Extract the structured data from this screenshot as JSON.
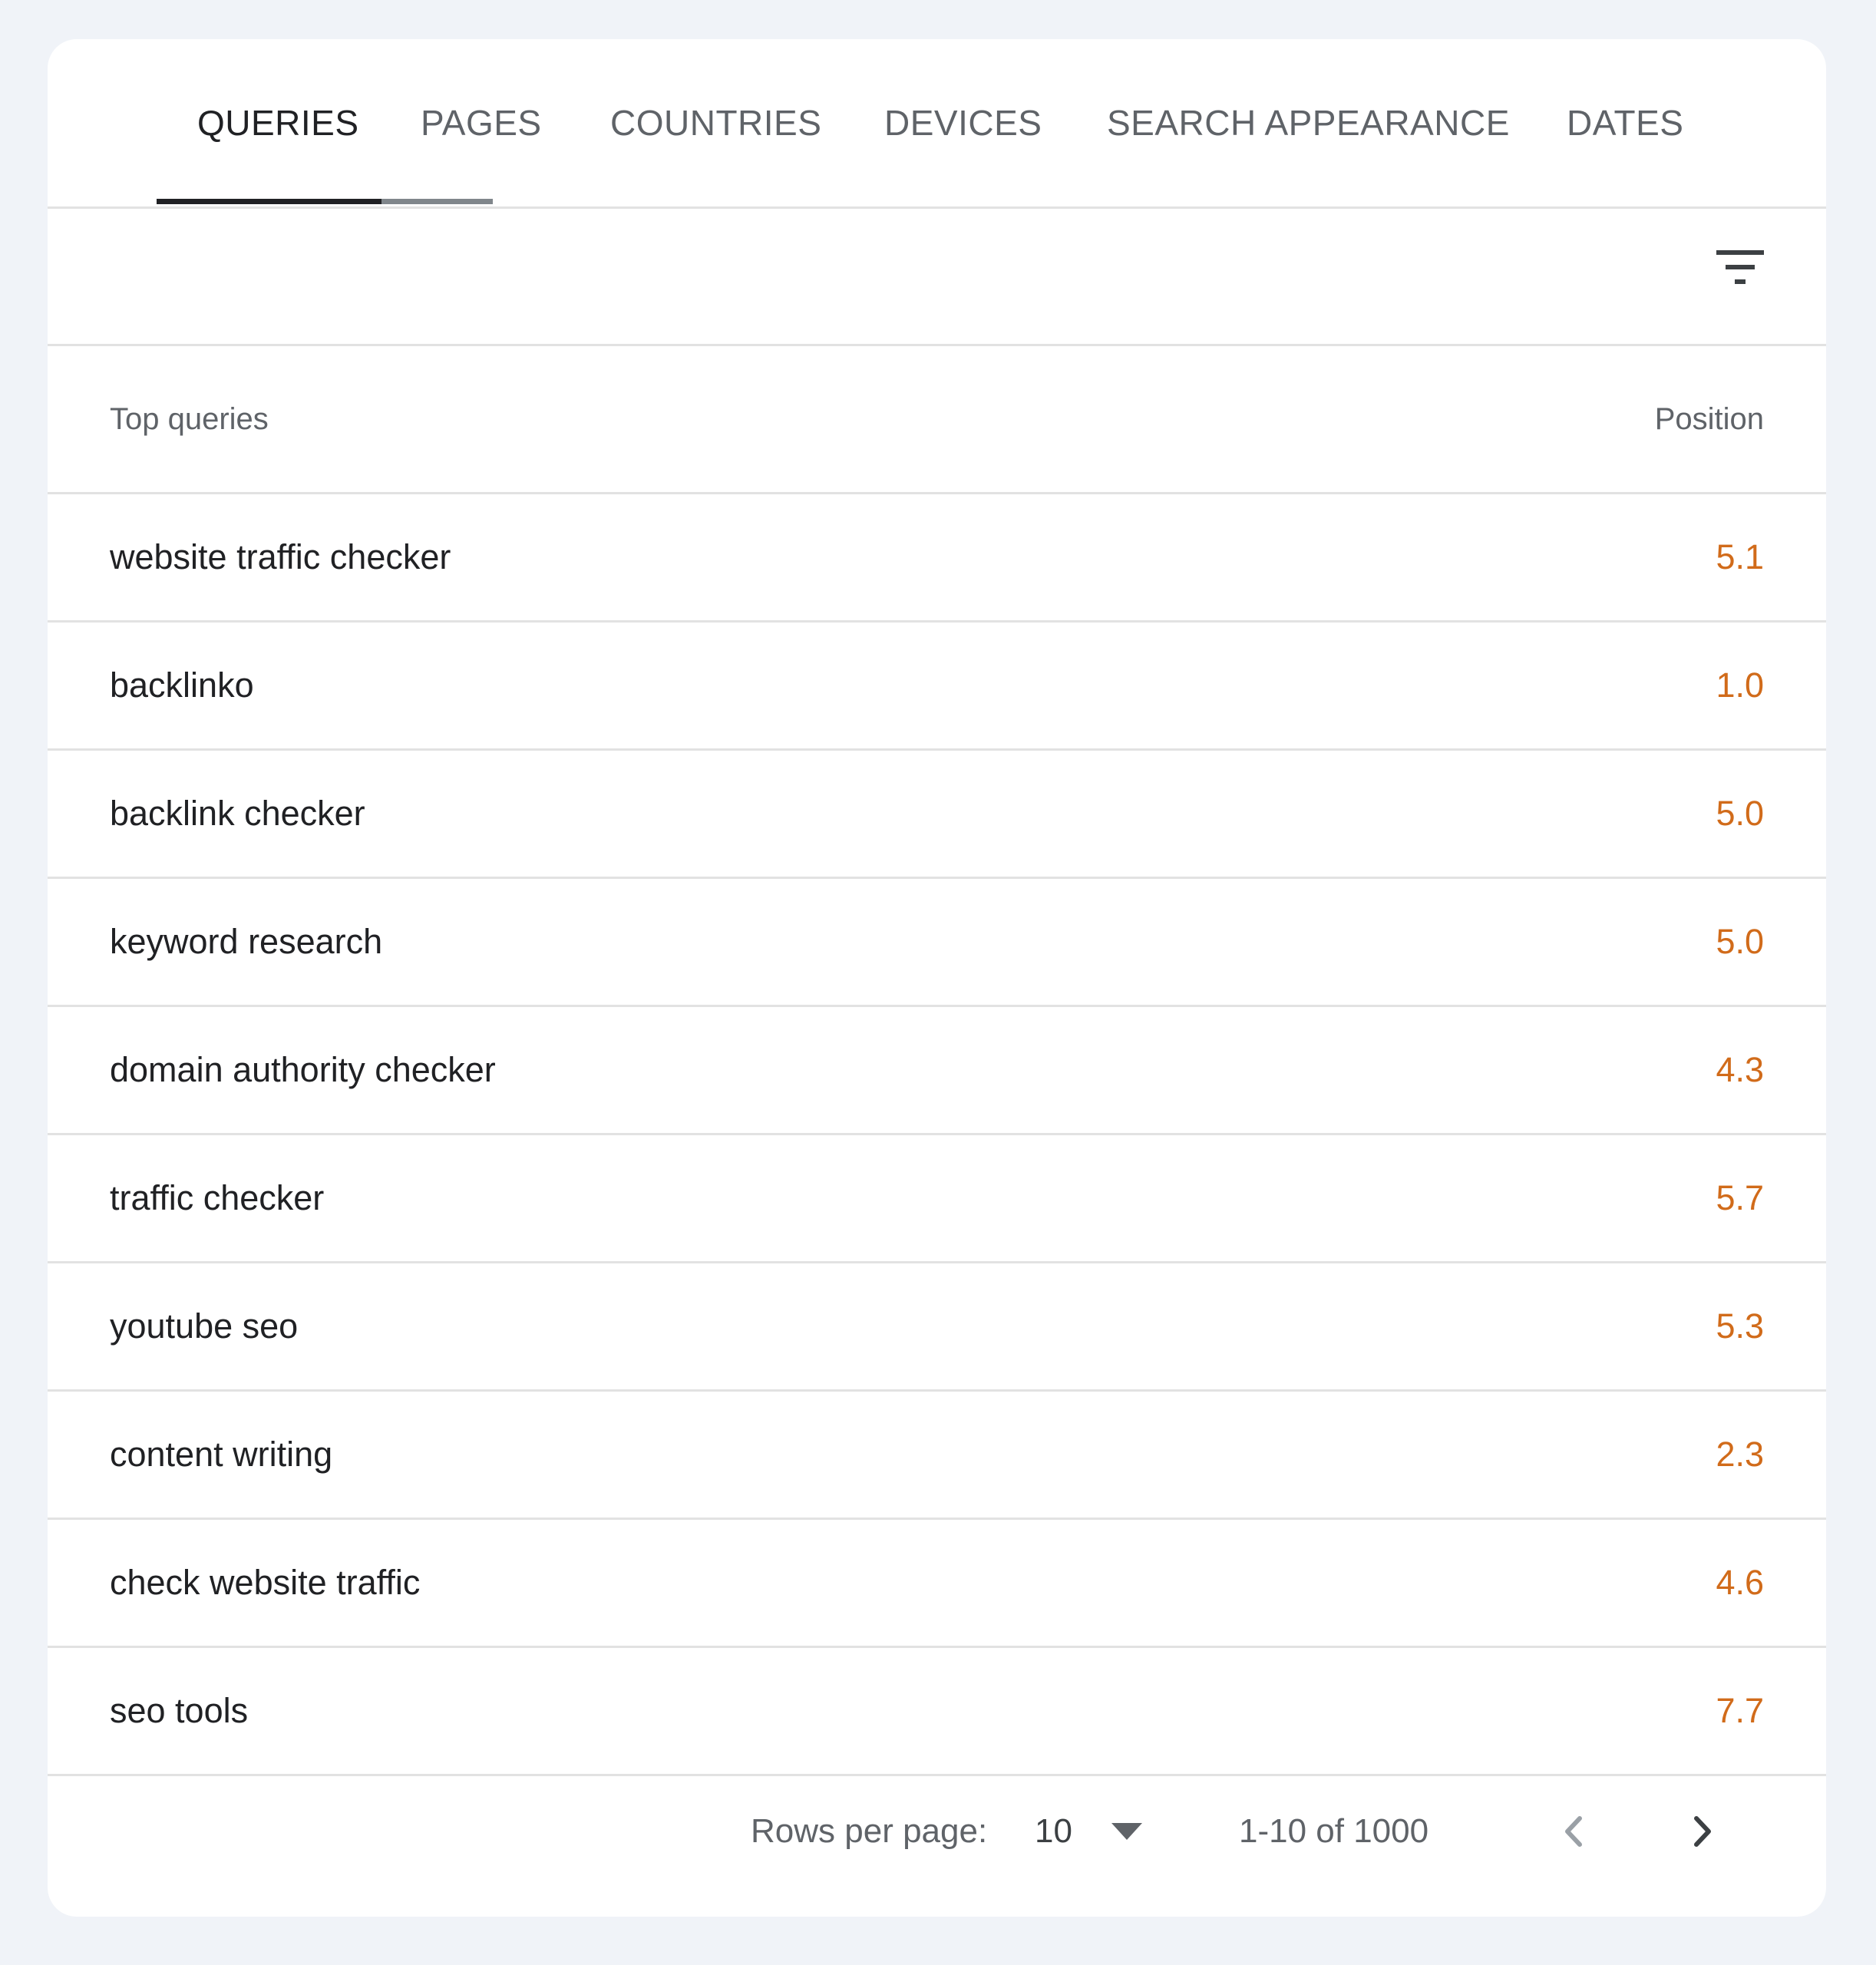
{
  "tabs": [
    {
      "label": "QUERIES",
      "active": true
    },
    {
      "label": "PAGES",
      "active": false
    },
    {
      "label": "COUNTRIES",
      "active": false
    },
    {
      "label": "DEVICES",
      "active": false
    },
    {
      "label": "SEARCH APPEARANCE",
      "active": false
    },
    {
      "label": "DATES",
      "active": false
    }
  ],
  "filter": {
    "icon": "filter-list-icon"
  },
  "table": {
    "header_query": "Top queries",
    "header_position": "Position",
    "rows": [
      {
        "query": "website traffic checker",
        "position": "5.1"
      },
      {
        "query": "backlinko",
        "position": "1.0"
      },
      {
        "query": "backlink checker",
        "position": "5.0"
      },
      {
        "query": "keyword research",
        "position": "5.0"
      },
      {
        "query": "domain authority checker",
        "position": "4.3"
      },
      {
        "query": "traffic checker",
        "position": "5.7"
      },
      {
        "query": "youtube seo",
        "position": "5.3"
      },
      {
        "query": "content writing",
        "position": "2.3"
      },
      {
        "query": "check website traffic",
        "position": "4.6"
      },
      {
        "query": "seo tools",
        "position": "7.7"
      }
    ]
  },
  "pagination": {
    "rows_per_page_label": "Rows per page:",
    "rows_per_page_value": "10",
    "range_text": "1-10 of 1000",
    "prev_icon": "chevron-left-icon",
    "next_icon": "chevron-right-icon"
  },
  "colors": {
    "background": "#f0f3f8",
    "card": "#ffffff",
    "active_tab": "#202124",
    "inactive_tab": "#5f6368",
    "position_value": "#d16b1a",
    "divider": "#e2e2e2"
  }
}
